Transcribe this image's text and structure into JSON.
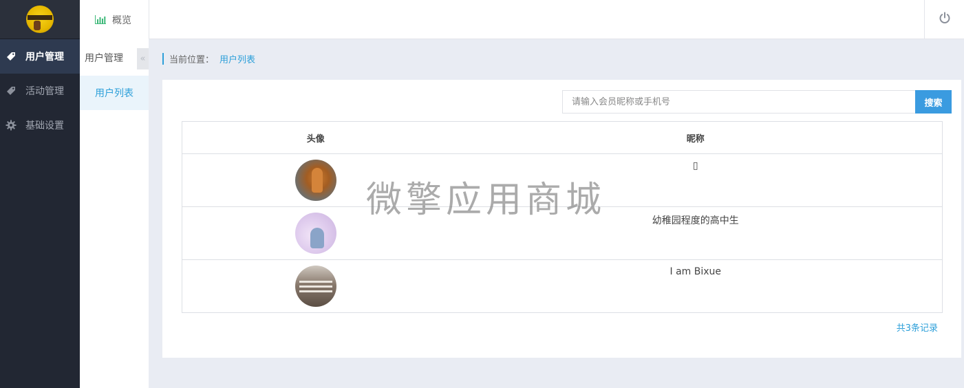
{
  "sidebar": {
    "logo_icon": "avatar-logo",
    "items": [
      {
        "label": "用户管理",
        "icon": "tag-icon",
        "active": true
      },
      {
        "label": "活动管理",
        "icon": "tag-icon",
        "active": false
      },
      {
        "label": "基础设置",
        "icon": "gear-icon",
        "active": false
      }
    ]
  },
  "header": {
    "overview_label": "概览",
    "overview_icon": "bar-chart-icon",
    "power_icon": "power-icon"
  },
  "subnav": {
    "title": "用户管理",
    "collapse_glyph": "«",
    "items": [
      {
        "label": "用户列表",
        "active": true
      }
    ]
  },
  "breadcrumb": {
    "label": "当前位置：",
    "current": "用户列表"
  },
  "search": {
    "placeholder": "请输入会员昵称或手机号",
    "value": "",
    "button_label": "搜索"
  },
  "table": {
    "headers": [
      "头像",
      "昵称"
    ],
    "rows": [
      {
        "avatar": "user-avatar-1",
        "nickname": "▯"
      },
      {
        "avatar": "user-avatar-2",
        "nickname": "幼稚园程度的高中生"
      },
      {
        "avatar": "user-avatar-3",
        "nickname": "I am Bixue"
      }
    ]
  },
  "footer": {
    "total": "共3条记录"
  },
  "watermark": "微擎应用商城",
  "colors": {
    "sidebar_bg": "#222733",
    "sidebar_active": "#2e3a50",
    "accent": "#2c9fd9",
    "search_button": "#3a9be0",
    "content_bg": "#e9ecf3"
  }
}
